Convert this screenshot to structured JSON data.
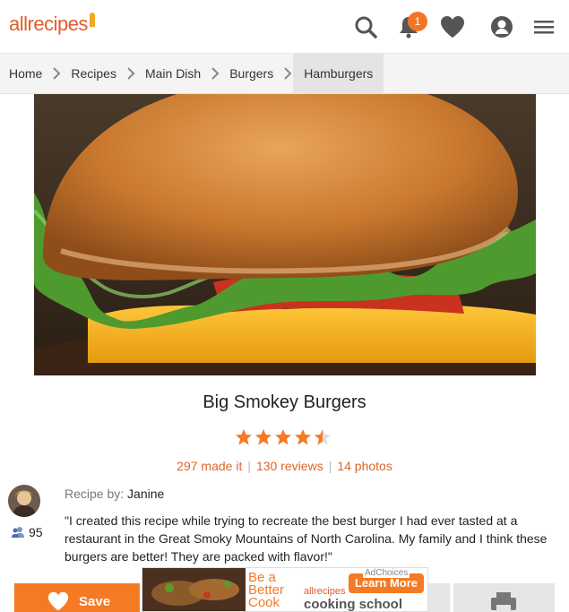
{
  "header": {
    "logo": "allrecipes",
    "notification_count": "1"
  },
  "breadcrumb": [
    "Home",
    "Recipes",
    "Main Dish",
    "Burgers",
    "Hamburgers"
  ],
  "recipe": {
    "title": "Big Smokey Burgers",
    "rating": 4.5,
    "made_it": "297 made it",
    "reviews": "130 reviews",
    "photos": "14 photos",
    "recipe_by_label": "Recipe by:",
    "author": "Janine",
    "followers": "95",
    "description": "\"I created this recipe while trying to recreate the best burger I had ever tasted at a restaurant in the Great Smoky Mountains of North Carolina. My family and I think these burgers are better! They are packed with flavor!\""
  },
  "actions": {
    "save_label": "Save"
  },
  "ad": {
    "headline": "Be a Better Cook",
    "brand": "allrecipes",
    "school": "cooking school",
    "cta": "Learn More",
    "adchoices": "AdChoices"
  },
  "colors": {
    "accent": "#f47a24",
    "star": "#f47a24"
  }
}
